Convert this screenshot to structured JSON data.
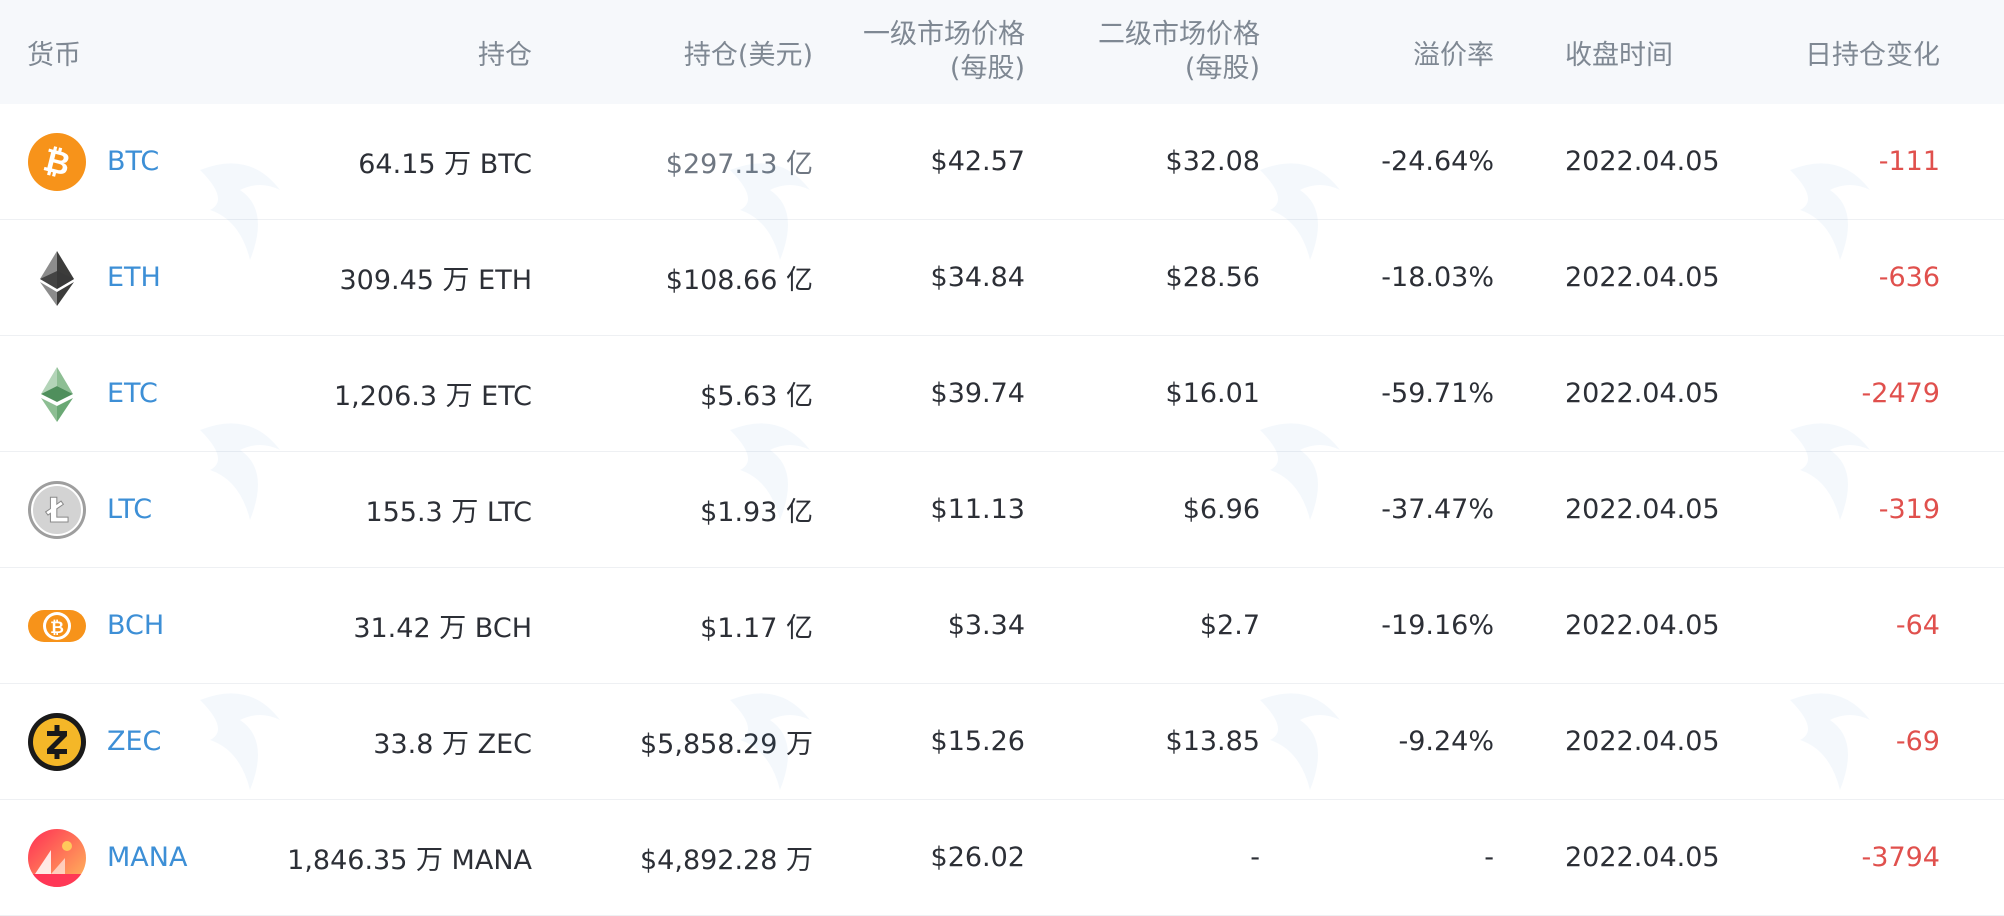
{
  "headers": {
    "coin": "货币",
    "holdings": "持仓",
    "holdings_usd": "持仓(美元)",
    "primary_price_line1": "一级市场价格",
    "primary_price_line2": "(每股)",
    "secondary_price_line1": "二级市场价格",
    "secondary_price_line2": "(每股)",
    "premium": "溢价率",
    "close_time": "收盘时间",
    "daily_change": "日持仓变化"
  },
  "colors": {
    "link_blue": "#3d8fd6",
    "negative_red": "#e0504d",
    "header_bg": "#f6f8fb",
    "header_text": "#7f8893"
  },
  "rows": [
    {
      "icon": "bitcoin-icon",
      "coin": "BTC",
      "holdings": "64.15 万 BTC",
      "holdings_usd": "$297.13 亿",
      "primary_price": "$42.57",
      "secondary_price": "$32.08",
      "premium": "-24.64%",
      "close_time": "2022.04.05",
      "daily_change": "-111"
    },
    {
      "icon": "ethereum-icon",
      "coin": "ETH",
      "holdings": "309.45 万 ETH",
      "holdings_usd": "$108.66 亿",
      "primary_price": "$34.84",
      "secondary_price": "$28.56",
      "premium": "-18.03%",
      "close_time": "2022.04.05",
      "daily_change": "-636"
    },
    {
      "icon": "ethereum-classic-icon",
      "coin": "ETC",
      "holdings": "1,206.3 万 ETC",
      "holdings_usd": "$5.63 亿",
      "primary_price": "$39.74",
      "secondary_price": "$16.01",
      "premium": "-59.71%",
      "close_time": "2022.04.05",
      "daily_change": "-2479"
    },
    {
      "icon": "litecoin-icon",
      "coin": "LTC",
      "holdings": "155.3 万 LTC",
      "holdings_usd": "$1.93 亿",
      "primary_price": "$11.13",
      "secondary_price": "$6.96",
      "premium": "-37.47%",
      "close_time": "2022.04.05",
      "daily_change": "-319"
    },
    {
      "icon": "bitcoin-cash-icon",
      "coin": "BCH",
      "holdings": "31.42 万 BCH",
      "holdings_usd": "$1.17 亿",
      "primary_price": "$3.34",
      "secondary_price": "$2.7",
      "premium": "-19.16%",
      "close_time": "2022.04.05",
      "daily_change": "-64"
    },
    {
      "icon": "zcash-icon",
      "coin": "ZEC",
      "holdings": "33.8 万 ZEC",
      "holdings_usd": "$5,858.29 万",
      "primary_price": "$15.26",
      "secondary_price": "$13.85",
      "premium": "-9.24%",
      "close_time": "2022.04.05",
      "daily_change": "-69"
    },
    {
      "icon": "decentraland-icon",
      "coin": "MANA",
      "holdings": "1,846.35 万 MANA",
      "holdings_usd": "$4,892.28 万",
      "primary_price": "$26.02",
      "secondary_price": "-",
      "premium": "-",
      "close_time": "2022.04.05",
      "daily_change": "-3794"
    }
  ]
}
